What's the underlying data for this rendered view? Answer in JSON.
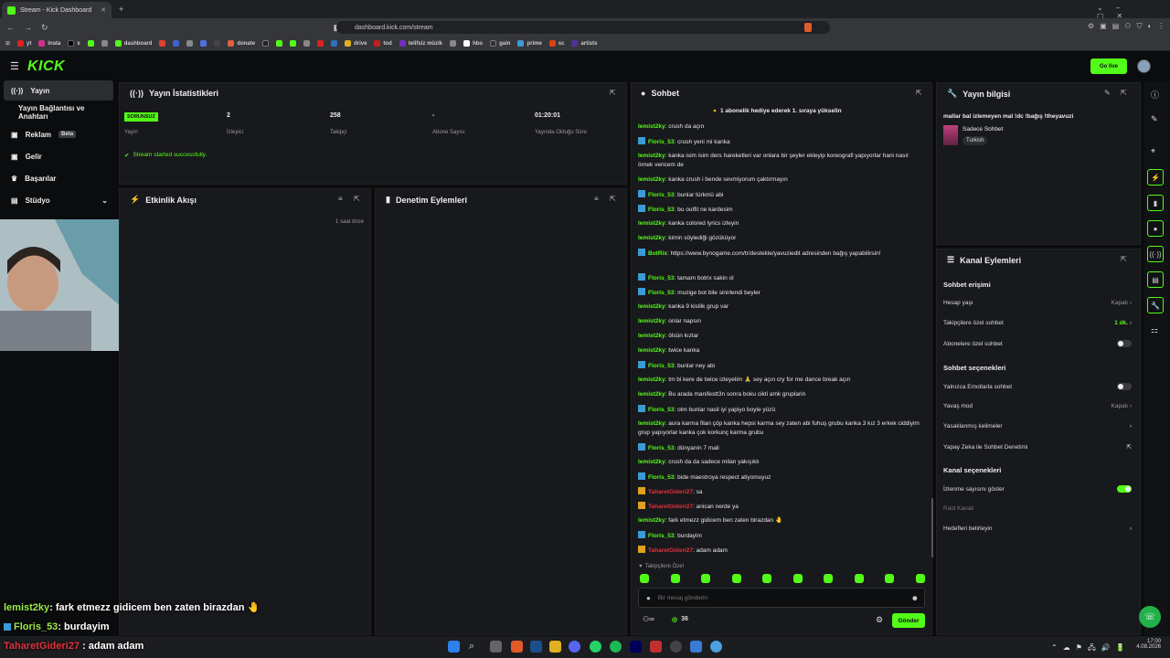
{
  "browser": {
    "tab_title": "Stream - Kick Dashboard",
    "url": "dashboard.kick.com/stream",
    "bookmarks": [
      "yt",
      "insta",
      "x",
      "dashboard",
      "donate",
      "drive",
      "tod",
      "telifsiz müzik",
      "hbo",
      "gain",
      "prime",
      "sc",
      "artists"
    ]
  },
  "header": {
    "logo": "KICK",
    "go_live": "Go live"
  },
  "sidebar": {
    "items": [
      {
        "label": "Yayın"
      },
      {
        "label": "Yayın Bağlantısı ve Anahtarı"
      },
      {
        "label": "Reklam",
        "badge": "Beta"
      },
      {
        "label": "Gelir"
      },
      {
        "label": "Başarılar"
      },
      {
        "label": "Stüdyo"
      }
    ]
  },
  "stats_panel": {
    "title": "Yayın İstatistikleri",
    "status_badge": "SORUNSUZ",
    "status_label": "Yayın",
    "viewers_value": "2",
    "viewers_label": "İzleyici",
    "followers_value": "258",
    "followers_label": "Takipçi",
    "subs_value": "-",
    "subs_label": "Abone Sayısı",
    "duration_value": "01:20:01",
    "duration_label": "Yayında Olduğu Süre",
    "success_msg": "Stream started successfully."
  },
  "activity_panel": {
    "title": "Etkinlik Akışı",
    "time": "1 saat önce"
  },
  "moderation_panel": {
    "title": "Denetim Eylemleri"
  },
  "chat": {
    "title": "Sohbet",
    "pinned": "1 abonelik hediye ederek 1. sıraya yükselin",
    "messages": [
      {
        "user": "lemist2ky",
        "text": "crush da açın",
        "type": "g"
      },
      {
        "user": "Floris_53",
        "text": "crush yeni mi kanka",
        "type": "b"
      },
      {
        "user": "lemist2ky",
        "text": "kanka isim isim ders hareketleri var onlara bir şeyler ekleyip koreografi yapıyorlar hani nasıl örnek vericem de",
        "type": "g"
      },
      {
        "user": "lemist2ky",
        "text": "kanka crush i bende sevmiyorum çaktırmayın",
        "type": "g"
      },
      {
        "user": "Floris_53",
        "text": "bunlar türkmü abi",
        "type": "b"
      },
      {
        "user": "Floris_53",
        "text": "bu outfit ne kardesim",
        "type": "b"
      },
      {
        "user": "lemist2ky",
        "text": "kanka colored lyrics izleyin",
        "type": "g"
      },
      {
        "user": "lemist2ky",
        "text": "kimin söylediği gözüküyor",
        "type": "g"
      },
      {
        "user": "BotRix",
        "text": "https://www.bynogame.com/tr/destekle/yavuziedit adresinden bağış yapabilirsin!",
        "type": "b"
      },
      {
        "user": "Floris_53",
        "text": "tamam botrix sakin ol",
        "type": "b"
      },
      {
        "user": "Floris_53",
        "text": "muzige bot bile sinirlendi beyler",
        "type": "b"
      },
      {
        "user": "lemist2ky",
        "text": "kanka 9 kisilik grup var",
        "type": "g"
      },
      {
        "user": "lemist2ky",
        "text": "onlar napsın",
        "type": "g"
      },
      {
        "user": "lemist2ky",
        "text": "ölsün kızlar",
        "type": "g"
      },
      {
        "user": "lemist2ky",
        "text": "twice kanka",
        "type": "g"
      },
      {
        "user": "Floris_53",
        "text": "bunlar ney abi",
        "type": "b"
      },
      {
        "user": "lemist2ky",
        "text": "tm bi kere de twice izleyelim 🙏 sey açın cry for me dance break açın",
        "type": "g"
      },
      {
        "user": "lemist2ky",
        "text": "Bu arada manifestt3n sonra boku cikti amk gruplarin",
        "type": "g"
      },
      {
        "user": "Floris_53",
        "text": "olm bunlar nasil iyi yapiyo boyle yüzü",
        "type": "b"
      },
      {
        "user": "lemist2ky",
        "text": "aura karma filan çöp kanka hepsi karma sey zaten abi fuhuş grubu kanka 3 kız 3 erkek ciddiyim grup yapıyorlar kanka çok korkunç karma grubu",
        "type": "g"
      },
      {
        "user": "Floris_53",
        "text": "dünyanin 7 mali",
        "type": "b"
      },
      {
        "user": "lemist2ky",
        "text": "crush da da sadece milan yakışıklı",
        "type": "g"
      },
      {
        "user": "Floris_53",
        "text": "bide maestroya respect atiyomuyuz",
        "type": "b"
      },
      {
        "user": "TaharetGideri27",
        "text": "sa",
        "type": "r"
      },
      {
        "user": "TaharetGideri27",
        "text": "anican nerde ya",
        "type": "r"
      },
      {
        "user": "lemist2ky",
        "text": "fark etmezz gidicem ben zaten birazdan 🤚",
        "type": "g"
      },
      {
        "user": "Floris_53",
        "text": "burdayim",
        "type": "b"
      },
      {
        "user": "TaharetGideri27",
        "text": "adam adam",
        "type": "r"
      }
    ],
    "followers_only": "Takipçilere Özel",
    "input_placeholder": "Bir mesaj gönderin",
    "count": "36",
    "send": "Gönder"
  },
  "info_panel": {
    "title": "Yayın bilgisi",
    "stream_title": "mallar bal izlemeyen mal !dc !bağış !theyavuzi",
    "category": "Sadece Sohbet",
    "tag": "Turkish"
  },
  "channel_panel": {
    "title": "Kanal Eylemleri",
    "chat_access": "Sohbet erişimi",
    "account_age": "Hesap yaşı",
    "account_age_val": "Kapalı",
    "followers_chat": "Takipçilere özel sohbet",
    "followers_chat_val": "1 dk.",
    "subs_chat": "Abonelere özel sohbet",
    "chat_options": "Sohbet seçenekleri",
    "emote_only": "Yalnızca Emotlarla sohbet",
    "slow_mode": "Yavaş mod",
    "slow_mode_val": "Kapalı",
    "banned_words": "Yasaklanmış kelimeler",
    "ai_mod": "Yapay Zeka ile Sohbet Denetimi",
    "channel_options": "Kanal seçenekleri",
    "show_viewers": "İzlenme sayısını göster",
    "raid": "Raid Kanalı",
    "goals": "Hedefleri belirleyin"
  },
  "overlay": [
    {
      "user": "lemist2ky",
      "text": ": fark etmezz gidicem ben zaten birazdan 🤚"
    },
    {
      "user": "Floris_53",
      "text": ": burdayim"
    },
    {
      "user": "TaharetGideri27",
      "text": ": adam adam"
    }
  ],
  "taskbar": {
    "time": "17:00",
    "date": "4.08.2026"
  }
}
